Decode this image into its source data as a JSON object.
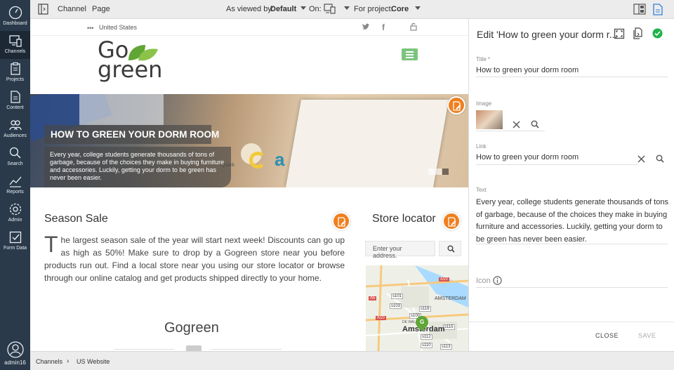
{
  "nav": {
    "items": [
      {
        "label": "Dashboard",
        "icon": "dashboard-icon"
      },
      {
        "label": "Channels",
        "icon": "channels-icon",
        "active": true
      },
      {
        "label": "Projects",
        "icon": "projects-icon"
      },
      {
        "label": "Content",
        "icon": "content-icon"
      },
      {
        "label": "Audiences",
        "icon": "audiences-icon"
      },
      {
        "label": "Search",
        "icon": "search-icon"
      },
      {
        "label": "Reports",
        "icon": "reports-icon"
      },
      {
        "label": "Admin",
        "icon": "admin-icon"
      },
      {
        "label": "Form Data",
        "icon": "form-data-icon"
      }
    ],
    "user": {
      "label": "admin16",
      "icon": "user-avatar-icon"
    }
  },
  "topbar": {
    "channel_label": "Channel",
    "page_label": "Page",
    "viewed_by_label": "As viewed by:",
    "viewed_by_value": "Default",
    "on_label": "On:",
    "project_label": "For project:",
    "project_value": "Core"
  },
  "site": {
    "country": "United States",
    "logo_line1": "Go",
    "logo_line2": "green",
    "hero": {
      "title": "HOW TO GREEN YOUR DORM ROOM",
      "text": "Every year, college students generate thousands of tons of garbage, because of the choices they make in buying furniture and accessories. Luckily, getting your dorm to be green has never been easier.",
      "quark": "Quark"
    },
    "sale": {
      "title": "Season Sale",
      "dropcap": "T",
      "body": "he largest season sale of the year will start next week! Discounts can go up as high as 50%! Make sure to drop by a Gogreen store near you before products run out. Find a local store near you using our store locator or browse through our online catalog and get products shipped directly to your home."
    },
    "footer_title": "Gogreen",
    "store": {
      "title": "Store locator",
      "placeholder": "Enter your address."
    },
    "map": {
      "amsterdam_upper": "AMSTERDAM",
      "amsterdam": "Amsterdam",
      "de_wallen": "DE WALLEN",
      "pin_letter": "G",
      "roads": [
        "A10",
        "A5",
        "s101",
        "s103",
        "s116",
        "s100",
        "A10",
        "s115",
        "s112",
        "s110",
        "s113"
      ]
    }
  },
  "breadcrumb": {
    "first": "Channels",
    "second": "US Website"
  },
  "panel": {
    "title": "Edit 'How to green your dorm r...",
    "title_label": "Title *",
    "title_value": "How to green your dorm room",
    "image_label": "Image",
    "link_label": "Link",
    "link_value": "How to green your dorm room",
    "text_label": "Text",
    "text_value": "Every year, college students generate thousands of tons of garbage, because of the choices they make in buying furniture and accessories. Luckily, getting your dorm to be green has never been easier.",
    "icon_label": "Icon",
    "close_label": "CLOSE",
    "save_label": "SAVE"
  },
  "colors": {
    "accent_orange": "#f07f1f",
    "accent_green": "#7cc47d",
    "nav_bg": "#2b3a4a",
    "save_ok": "#1fb34a"
  }
}
